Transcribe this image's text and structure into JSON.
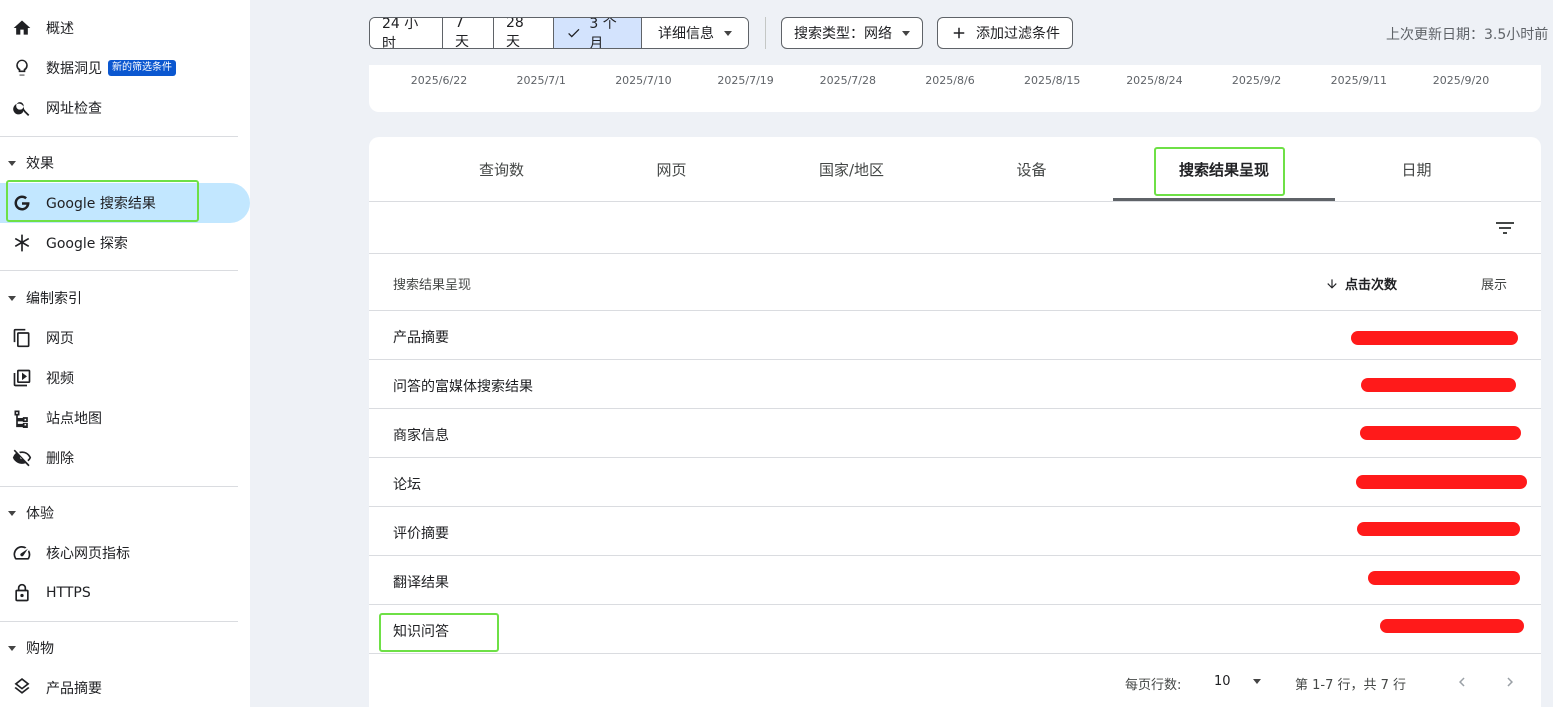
{
  "sidebar": {
    "top_items": [
      {
        "label": "概述",
        "icon": "home-icon"
      },
      {
        "label": "数据洞见",
        "icon": "lightbulb-icon",
        "badge": "新的筛选条件"
      },
      {
        "label": "网址检查",
        "icon": "search-icon"
      }
    ],
    "sections": [
      {
        "title": "效果",
        "items": [
          {
            "label": "Google 搜索结果",
            "icon": "google-g-icon",
            "active": true
          },
          {
            "label": "Google 探索",
            "icon": "asterisk-icon"
          }
        ]
      },
      {
        "title": "编制索引",
        "items": [
          {
            "label": "网页",
            "icon": "pages-icon"
          },
          {
            "label": "视频",
            "icon": "video-icon"
          },
          {
            "label": "站点地图",
            "icon": "sitemap-icon"
          },
          {
            "label": "删除",
            "icon": "eye-off-icon"
          }
        ]
      },
      {
        "title": "体验",
        "items": [
          {
            "label": "核心网页指标",
            "icon": "speed-icon"
          },
          {
            "label": "HTTPS",
            "icon": "lock-icon"
          }
        ]
      },
      {
        "title": "购物",
        "items": [
          {
            "label": "产品摘要",
            "icon": "layers-icon"
          }
        ]
      }
    ]
  },
  "toolbar": {
    "ranges": [
      "24 小时",
      "7 天",
      "28 天",
      "3 个月"
    ],
    "selected_range": "3 个月",
    "details_label": "详细信息",
    "search_type_label": "搜索类型：网络",
    "add_filter_label": "添加过滤条件",
    "last_updated": "上次更新日期：3.5小时前"
  },
  "chart": {
    "x_ticks": [
      "2025/6/22",
      "2025/7/1",
      "2025/7/10",
      "2025/7/19",
      "2025/7/28",
      "2025/8/6",
      "2025/8/15",
      "2025/8/24",
      "2025/9/2",
      "2025/9/11",
      "2025/9/20"
    ]
  },
  "tabs": [
    "查询数",
    "网页",
    "国家/地区",
    "设备",
    "搜索结果呈现",
    "日期"
  ],
  "active_tab": "搜索结果呈现",
  "table": {
    "columns": {
      "name": "搜索结果呈现",
      "clicks": "点击次数",
      "impressions": "展示"
    },
    "sorted_by": "点击次数",
    "rows": [
      "产品摘要",
      "问答的富媒体搜索结果",
      "商家信息",
      "论坛",
      "评价摘要",
      "翻译结果",
      "知识问答"
    ]
  },
  "pager": {
    "rows_per_page_label": "每页行数:",
    "rows_per_page": "10",
    "range_text": "第 1-7 行，共 7 行"
  },
  "colors": {
    "highlight": "#6ee046",
    "redaction": "#ff1a1a",
    "active_nav": "#c2e7ff",
    "selected_segment": "#d3e3fd",
    "badge": "#0b57d0"
  }
}
